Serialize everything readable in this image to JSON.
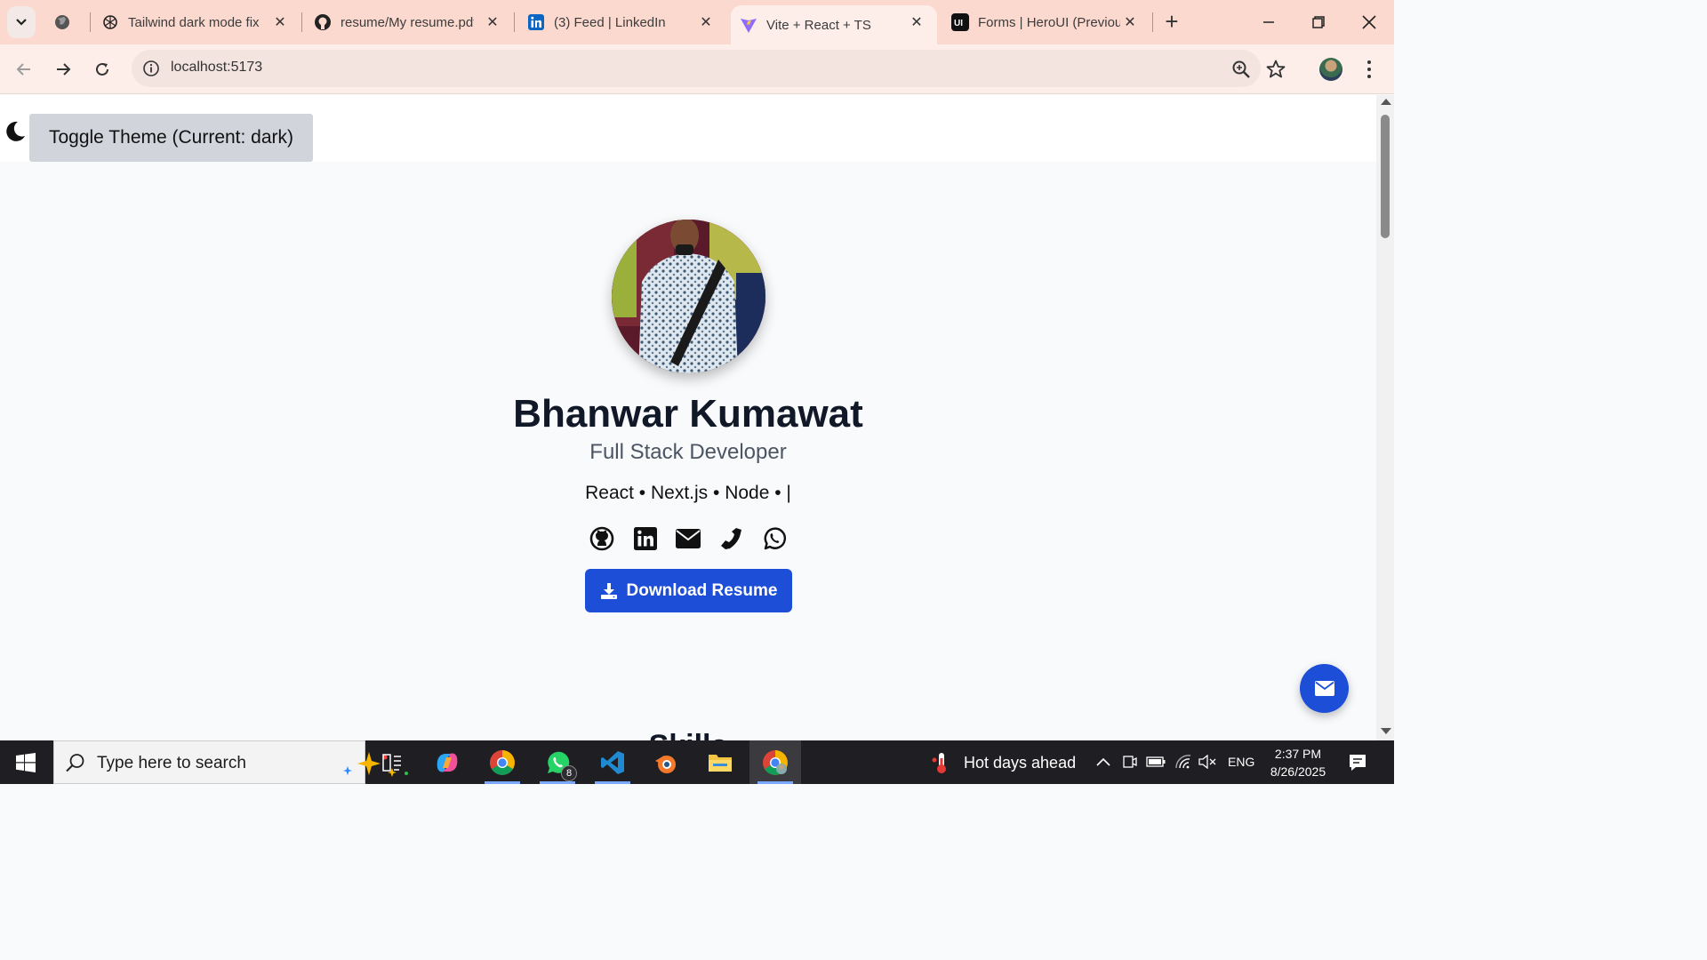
{
  "browser": {
    "tabs": [
      {
        "title": "Tailwind dark mode fix",
        "icon": "openai-icon",
        "active": false
      },
      {
        "title": "resume/My resume.pdf",
        "icon": "github-icon",
        "active": false
      },
      {
        "title": "(3) Feed | LinkedIn",
        "icon": "linkedin-icon",
        "active": false
      },
      {
        "title": "Vite + React + TS",
        "icon": "vite-icon",
        "active": true
      },
      {
        "title": "Forms | HeroUI (Previou",
        "icon": "heroui-icon",
        "active": false
      }
    ],
    "address_bar": {
      "url": "localhost:5173"
    },
    "tab_strip_color": "#fcd9cf"
  },
  "page": {
    "theme_toggle_label": "Toggle Theme (Current: dark)",
    "name": "Bhanwar Kumawat",
    "role": "Full Stack Developer",
    "typed_skills": "React • Next.js • Node • |",
    "socials": [
      "github-icon",
      "linkedin-icon",
      "envelope-icon",
      "phone-icon",
      "whatsapp-icon"
    ],
    "download_label": "Download Resume",
    "next_section_heading": "Skills",
    "accent_color": "#1d4ed8"
  },
  "taskbar": {
    "search_placeholder": "Type here to search",
    "pinned_apps": [
      "task-view-icon",
      "copilot-icon",
      "chrome-icon",
      "whatsapp-icon",
      "vscode-icon",
      "blender-icon",
      "file-explorer-icon",
      "chrome-profile-icon"
    ],
    "whatsapp_badge": "8",
    "weather_text": "Hot days ahead",
    "language": "ENG",
    "time": "2:37 PM",
    "date": "8/26/2025"
  }
}
